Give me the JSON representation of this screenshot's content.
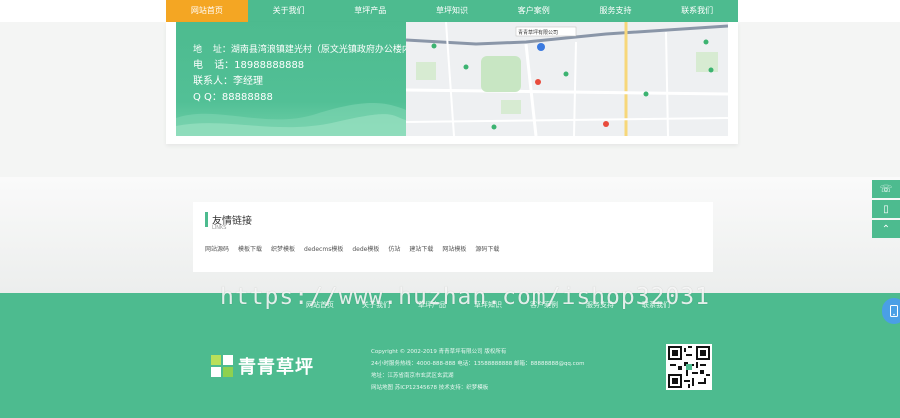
{
  "nav": {
    "items": [
      "网站首页",
      "关于我们",
      "草坪产品",
      "草坪知识",
      "客户案例",
      "服务支持",
      "联系我们"
    ],
    "active": 0
  },
  "contact": {
    "address_label": "地",
    "address_value": "址：湖南县湾浪镇建光村（原文光镇政府办公楼内）",
    "phone_label": "电",
    "phone_value": "话：18988888888",
    "person": "联系人：李经理",
    "qq": "Q Q：88888888"
  },
  "map": {
    "poi": "青青草坪有限公司"
  },
  "links": {
    "title": "友情链接",
    "subtitle": "LINKS",
    "items": [
      "网站源码",
      "模板下载",
      "织梦模板",
      "dedecms模板",
      "dede模板",
      "仿站",
      "建站下载",
      "网站模板",
      "源码下载"
    ]
  },
  "footer": {
    "nav": [
      "网站首页",
      "关于我们",
      "草坪产品",
      "草坪知识",
      "客户案例",
      "服务支持",
      "联系我们"
    ],
    "logo_text": "青青草坪",
    "copyright": "Copyright © 2002-2019 青青草坪有限公司 版权所有",
    "hotline": "24小时服务热线：4000-888-888 电话：13588888888 邮箱：88888888@qq.com",
    "address": "地址：江苏省南京市玄武区玄武湖",
    "icp": "网站地图 苏ICP12345678 技术支持：织梦模板"
  },
  "watermark": "https://www.huzhan.com/ishop32031",
  "colors": {
    "brand": "#4dbb8f",
    "active": "#f4a623"
  }
}
